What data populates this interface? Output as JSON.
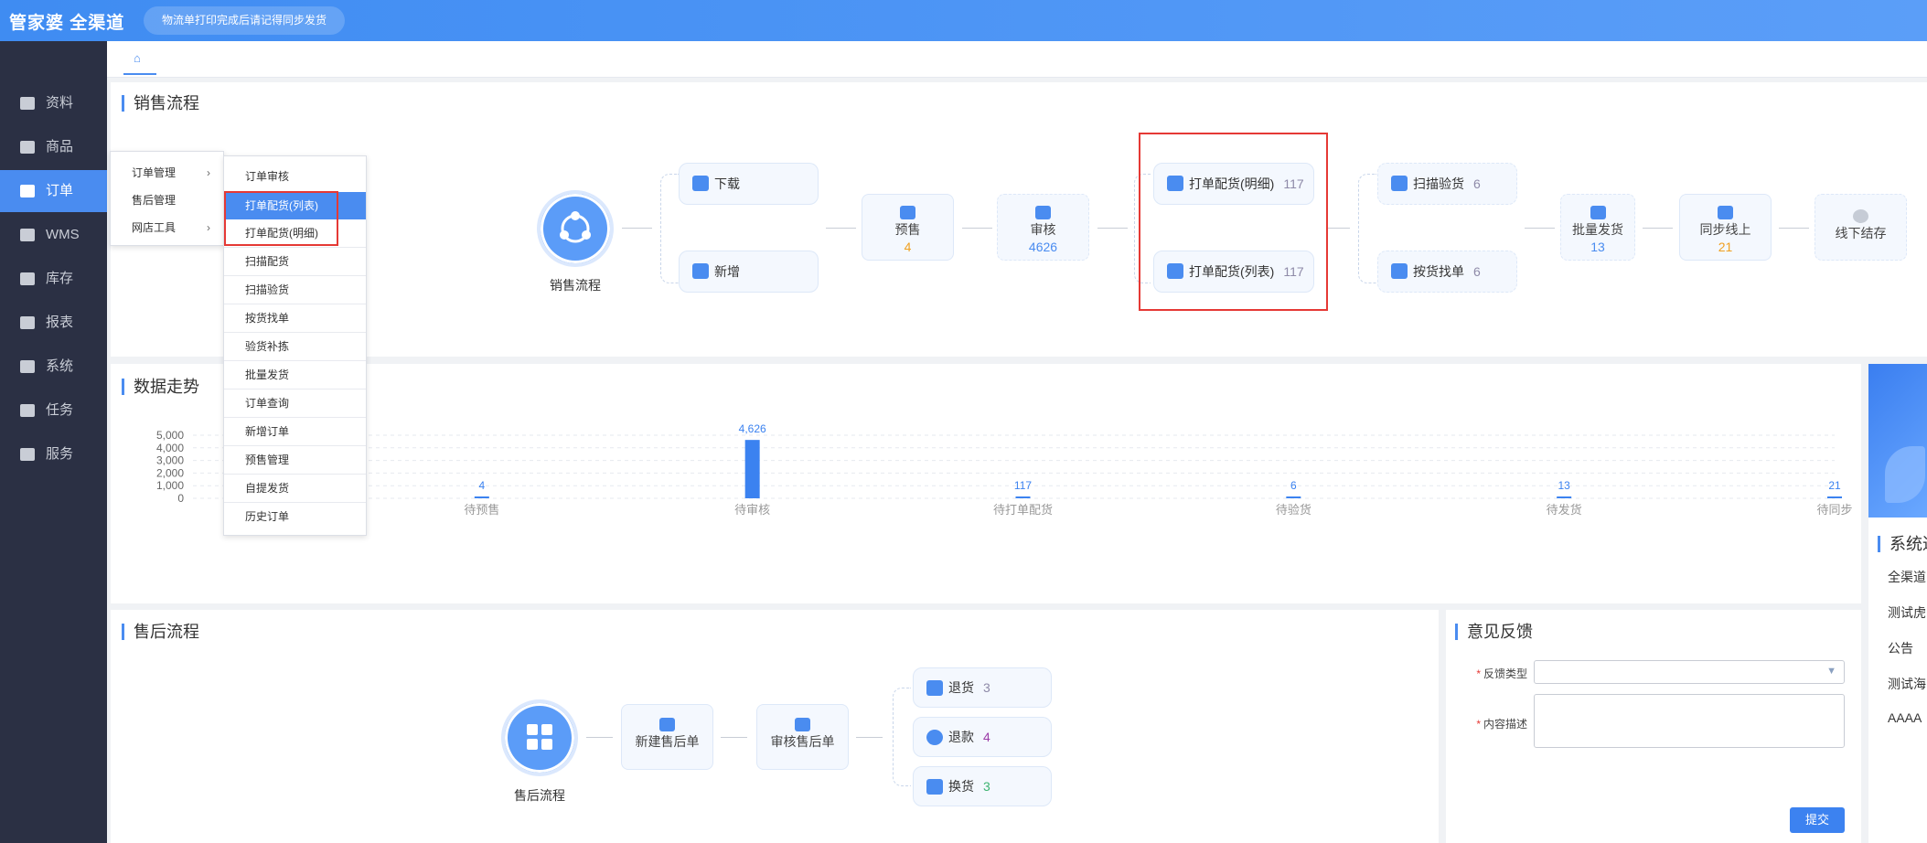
{
  "header": {
    "logo": "管家婆 全渠道",
    "notice": "物流单打印完成后请记得同步发货"
  },
  "sidebar": {
    "items": [
      {
        "label": "资料",
        "icon": "document-icon"
      },
      {
        "label": "商品",
        "icon": "goods-icon"
      },
      {
        "label": "订单",
        "icon": "order-icon",
        "active": true
      },
      {
        "label": "WMS",
        "icon": "cube-icon"
      },
      {
        "label": "库存",
        "icon": "warehouse-icon"
      },
      {
        "label": "报表",
        "icon": "bar-chart-icon"
      },
      {
        "label": "系统",
        "icon": "monitor-icon"
      },
      {
        "label": "任务",
        "icon": "task-icon"
      },
      {
        "label": "服务",
        "icon": "service-icon"
      }
    ]
  },
  "tabs": {
    "home_icon": "home-icon"
  },
  "sales": {
    "title": "销售流程",
    "center_label": "销售流程",
    "download": "下载",
    "add": "新增",
    "presale": {
      "label": "预售",
      "value": "4"
    },
    "audit": {
      "label": "审核",
      "value": "4626"
    },
    "print_detail": {
      "label": "打单配货(明细)",
      "value": "117"
    },
    "print_list": {
      "label": "打单配货(列表)",
      "value": "117"
    },
    "scan_check": {
      "label": "扫描验货",
      "value": "6"
    },
    "find_order": {
      "label": "按货找单",
      "value": "6"
    },
    "batch_ship": {
      "label": "批量发货",
      "value": "13"
    },
    "sync_online": {
      "label": "同步线上",
      "value": "21"
    },
    "offline_settle": {
      "label": "线下结存"
    }
  },
  "menu1": {
    "items": [
      "订单管理",
      "售后管理",
      "网店工具"
    ]
  },
  "menu2": {
    "items": [
      "订单审核",
      "打单配货(列表)",
      "打单配货(明细)",
      "扫描配货",
      "扫描验货",
      "按货找单",
      "验货补拣",
      "批量发货",
      "订单查询",
      "新增订单",
      "预售管理",
      "自提发货",
      "历史订单"
    ]
  },
  "trend": {
    "title": "数据走势"
  },
  "chart_data": {
    "type": "bar",
    "categories": [
      "",
      "待预售",
      "待审核",
      "待打单配货",
      "待验货",
      "待发货",
      "待同步"
    ],
    "values": [
      0,
      4,
      4626,
      117,
      6,
      13,
      21
    ],
    "data_labels": [
      "",
      "4",
      "4,626",
      "117",
      "6",
      "13",
      "21"
    ],
    "ylim": [
      0,
      5000
    ],
    "yticks": [
      "5,000",
      "4,000",
      "3,000",
      "2,000",
      "1,000",
      "0"
    ],
    "grid": true,
    "color": "#3b82f0"
  },
  "after_sales": {
    "title": "售后流程",
    "center_label": "售后流程",
    "new_aftersale": "新建售后单",
    "audit_aftersale": "审核售后单",
    "return": {
      "label": "退货",
      "value": "3"
    },
    "refund": {
      "label": "退款",
      "value": "4"
    },
    "exchange": {
      "label": "换货",
      "value": "3"
    }
  },
  "feedback": {
    "title": "意见反馈",
    "type_label": "反馈类型",
    "content_label": "内容描述",
    "required_mark": "*",
    "submit": "提交"
  },
  "system": {
    "title": "系统通",
    "items": [
      "全渠道",
      "测试虎",
      "公告",
      "测试海",
      "AAAA"
    ]
  },
  "colors": {
    "accent": "#4a8cf0",
    "sidebar": "#2b3044",
    "highlight": "#e53935",
    "orange": "#f0a020",
    "purple": "#9b59b6",
    "green": "#3cb371"
  }
}
